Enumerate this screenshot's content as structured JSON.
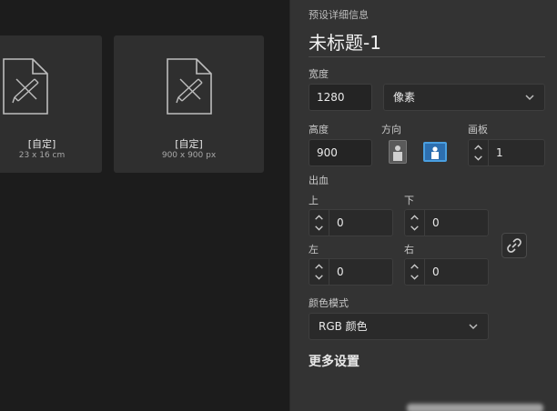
{
  "presets": [
    {
      "title": "[自定]",
      "subtitle": "23 x 16 cm"
    },
    {
      "title": "[自定]",
      "subtitle": "900 x 900 px"
    }
  ],
  "details": {
    "header": "预设详细信息",
    "doc_title": "未标题-1",
    "width_label": "宽度",
    "width_value": "1280",
    "unit_value": "像素",
    "height_label": "高度",
    "height_value": "900",
    "orientation_label": "方向",
    "artboard_label": "画板",
    "artboard_value": "1",
    "bleed_label": "出血",
    "bleed_top_label": "上",
    "bleed_top_value": "0",
    "bleed_bottom_label": "下",
    "bleed_bottom_value": "0",
    "bleed_left_label": "左",
    "bleed_left_value": "0",
    "bleed_right_label": "右",
    "bleed_right_value": "0",
    "color_mode_label": "颜色模式",
    "color_mode_value": "RGB 颜色",
    "more_settings": "更多设置"
  },
  "colors": {
    "accent": "#4a9fe0",
    "panel_bg": "#333333",
    "gallery_bg": "#1c1c1c"
  }
}
